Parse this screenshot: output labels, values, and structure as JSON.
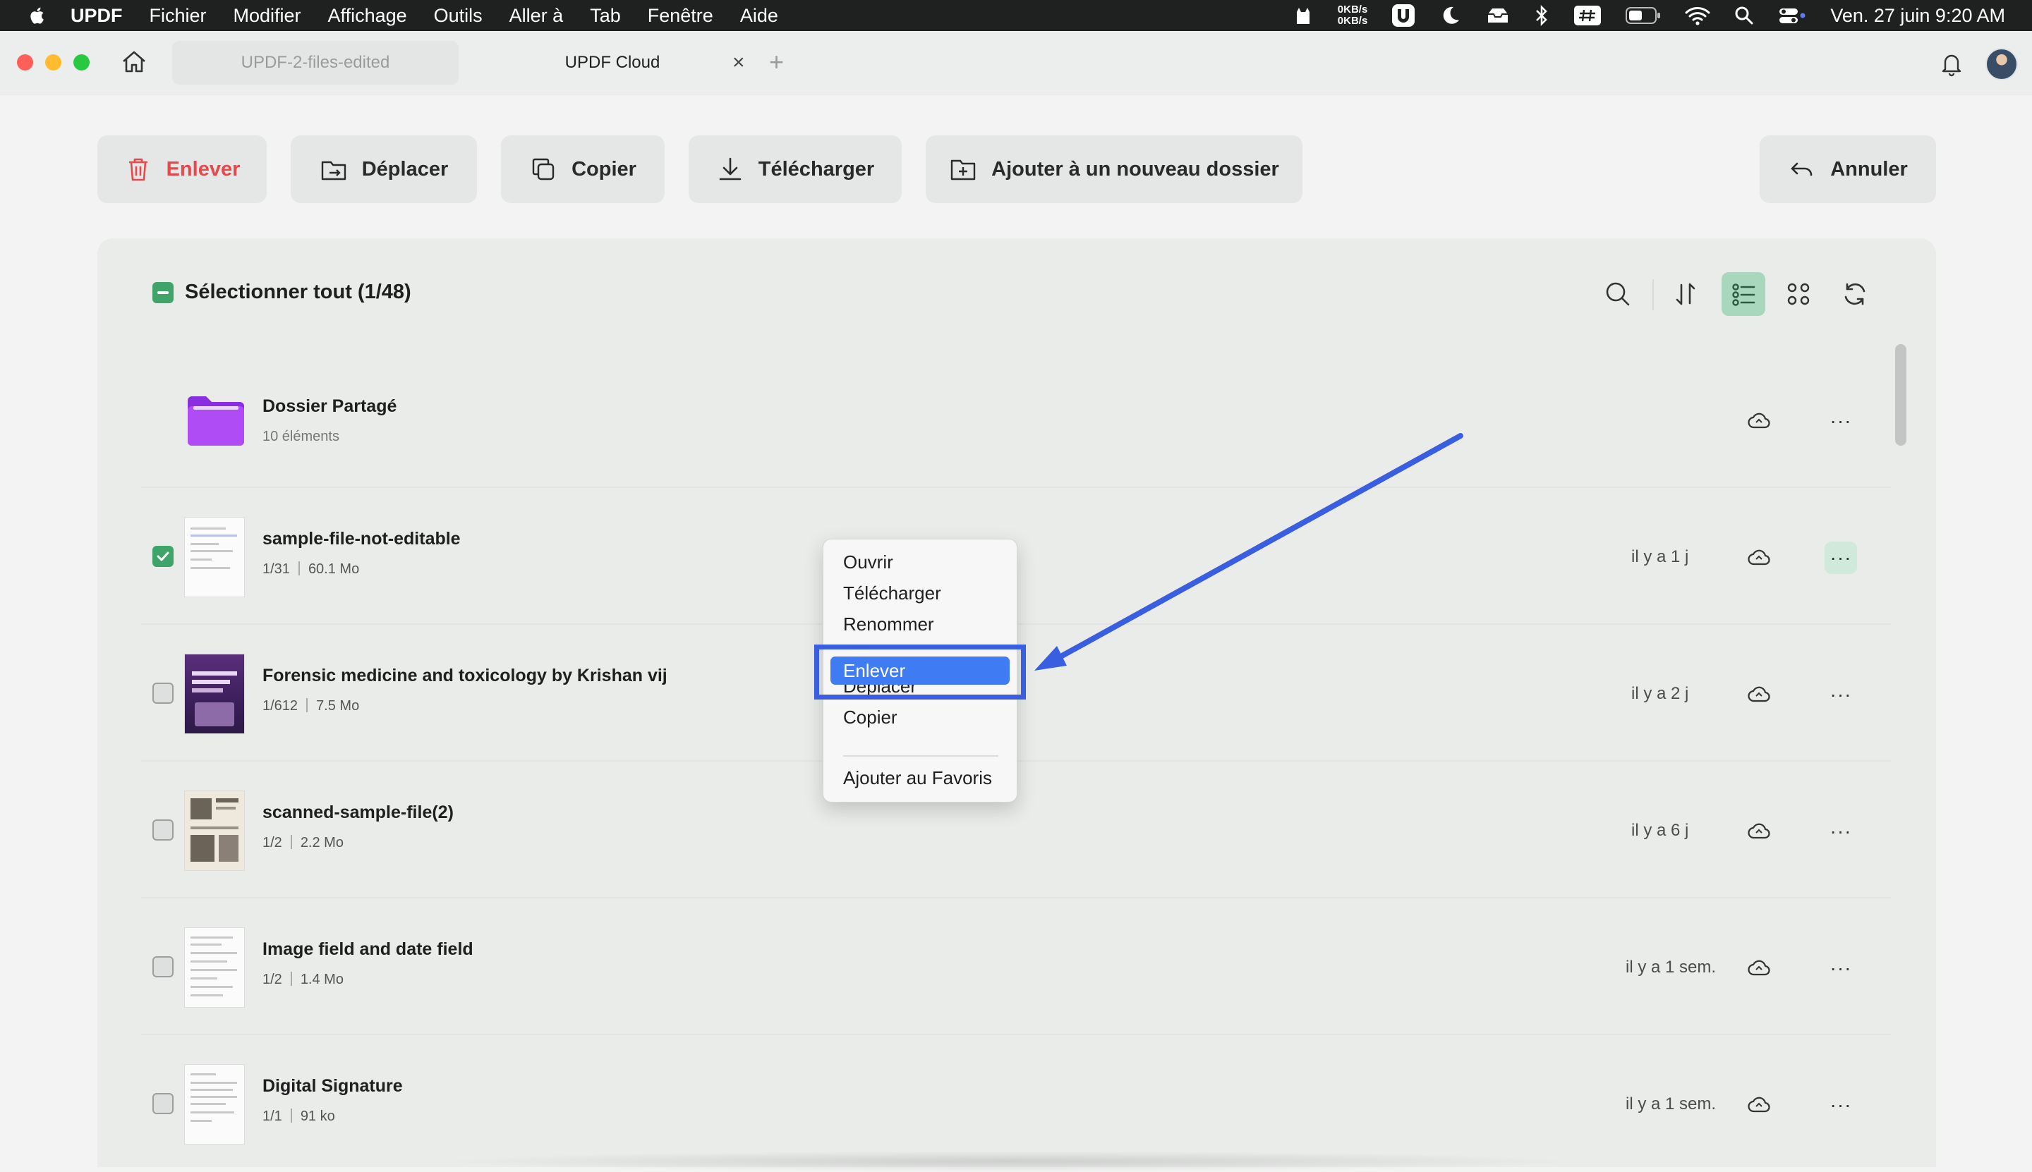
{
  "menubar": {
    "app_name": "UPDF",
    "items": [
      "Fichier",
      "Modifier",
      "Affichage",
      "Outils",
      "Aller à",
      "Tab",
      "Fenêtre",
      "Aide"
    ],
    "net_up": "0KB/s",
    "net_down": "0KB/s",
    "clock": "Ven. 27 juin  9:20 AM"
  },
  "tabs": {
    "inactive": "UPDF-2-files-edited",
    "active": "UPDF Cloud",
    "close_glyph": "×",
    "add_glyph": "+"
  },
  "toolbar": {
    "remove": "Enlever",
    "move": "Déplacer",
    "copy": "Copier",
    "download": "Télécharger",
    "new_folder": "Ajouter à un nouveau dossier",
    "cancel": "Annuler"
  },
  "panel": {
    "select_all": "Sélectionner tout (1/48)"
  },
  "folder": {
    "name": "Dossier Partagé",
    "count": "10 éléments"
  },
  "files": [
    {
      "name": "sample-file-not-editable",
      "pages": "1/31",
      "size": "60.1 Mo",
      "time": "il y a 1 j",
      "checked": true
    },
    {
      "name": "Forensic medicine and toxicology  by Krishan vij",
      "pages": "1/612",
      "size": "7.5 Mo",
      "time": "il y a 2 j",
      "checked": false
    },
    {
      "name": "scanned-sample-file(2)",
      "pages": "1/2",
      "size": "2.2 Mo",
      "time": "il y a 6 j",
      "checked": false
    },
    {
      "name": "Image field and date field",
      "pages": "1/2",
      "size": "1.4 Mo",
      "time": "il y a 1 sem.",
      "checked": false
    },
    {
      "name": "Digital Signature",
      "pages": "1/1",
      "size": "91 ko",
      "time": "il y a 1 sem.",
      "checked": false
    }
  ],
  "context_menu": {
    "items": [
      "Ouvrir",
      "Télécharger",
      "Renommer",
      "Enlever",
      "Déplacer",
      "Copier",
      "Ajouter au Favoris"
    ],
    "selected": "Enlever"
  },
  "colors": {
    "accent_green": "#3fa46a",
    "danger_red": "#e5484d",
    "menu_selection": "#3f7cf3",
    "annotation_blue": "#3a5ee0",
    "folder_purple": "#a13ff0"
  },
  "more_glyph": "···"
}
